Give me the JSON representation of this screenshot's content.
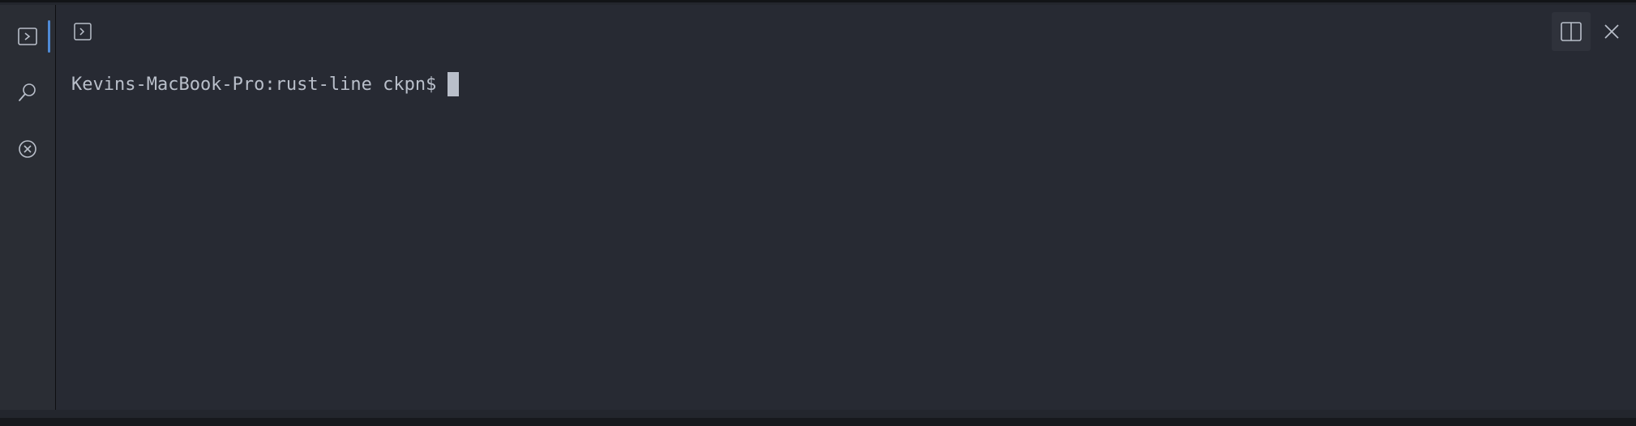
{
  "terminal": {
    "prompt": "Kevins-MacBook-Pro:rust-line ckpn$"
  },
  "icons": {
    "activity": [
      "terminal-icon",
      "search-icon",
      "close-circle-icon"
    ],
    "header": [
      "terminal-tab-icon",
      "split-pane-icon",
      "close-icon"
    ]
  },
  "colors": {
    "panel_background": "#272a33",
    "activity_background": "#2a2d34",
    "active_indicator": "#4f8bd6",
    "text": "#b9bfca"
  }
}
